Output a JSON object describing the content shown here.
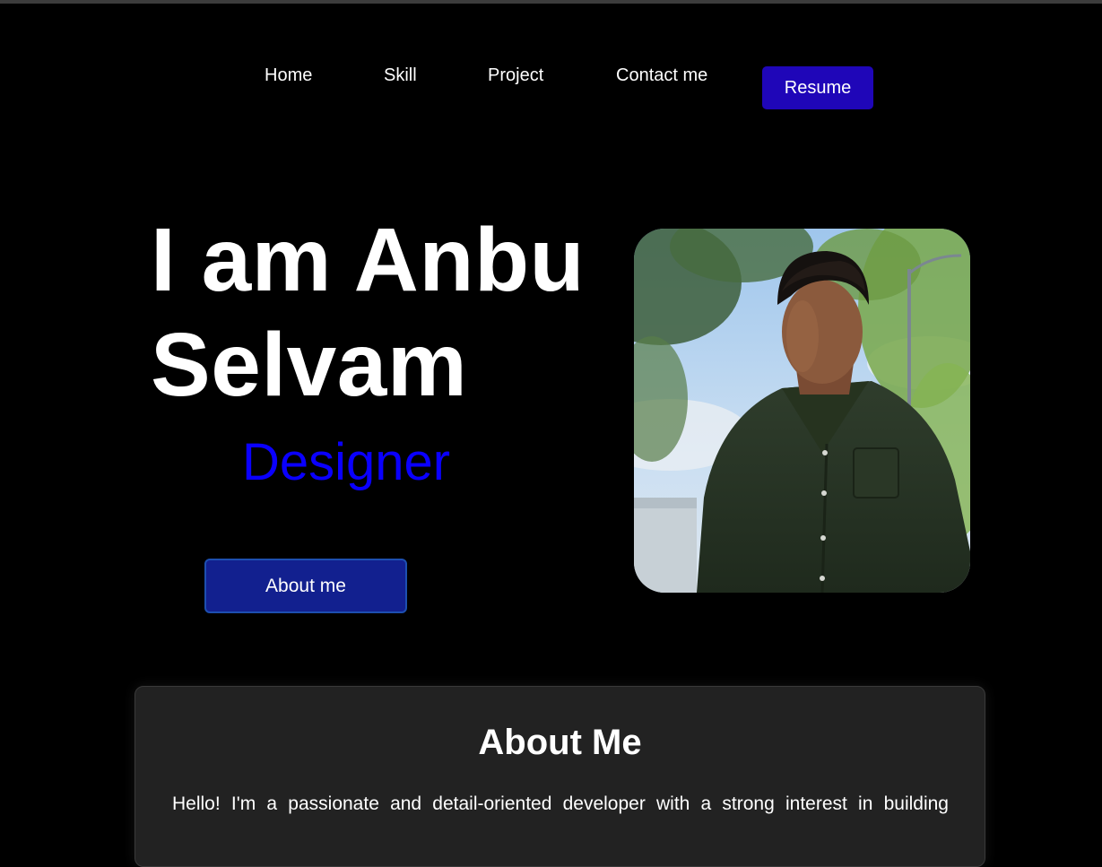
{
  "nav": {
    "home": "Home",
    "skill": "Skill",
    "project": "Project",
    "contact": "Contact me",
    "resume": "Resume"
  },
  "hero": {
    "title_line1": "I am Anbu",
    "title_line2": "Selvam",
    "role": "Designer",
    "about_button": "About me",
    "photo_icon": "profile-photo"
  },
  "about": {
    "heading": "About Me",
    "text": "Hello! I'm a passionate and detail-oriented developer with a strong interest in building"
  },
  "colors": {
    "background": "#000000",
    "resume_button": "#1f06b8",
    "role_text": "#0a00ff",
    "about_button": "#12208f",
    "card_background": "#222222"
  }
}
